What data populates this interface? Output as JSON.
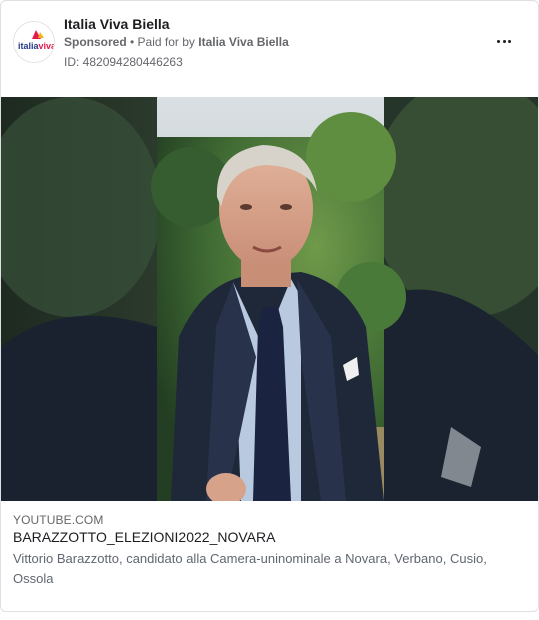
{
  "header": {
    "page_name": "Italia Viva Biella",
    "sponsored": "Sponsored",
    "separator": " • ",
    "paid_for_prefix": "Paid for by ",
    "payer": "Italia Viva Biella",
    "ad_id": "ID: 482094280446263",
    "avatar_text_part1": "italia",
    "avatar_text_part2": "viva"
  },
  "media": {
    "type": "video",
    "content": "man in suit speaking to camera, garden background"
  },
  "link_preview": {
    "domain": "YOUTUBE.COM",
    "title": "BARAZZOTTO_ELEZIONI2022_NOVARA",
    "description": "Vittorio Barazzotto, candidato alla Camera-uninominale a Novara, Verbano, Cusio, Ossola"
  },
  "icons": {
    "more": "more-options-icon",
    "logo": "italia-viva-logo-icon"
  },
  "colors": {
    "logo_red": "#e6194b",
    "logo_blue": "#243a8c",
    "logo_yellow": "#f3b21a"
  }
}
